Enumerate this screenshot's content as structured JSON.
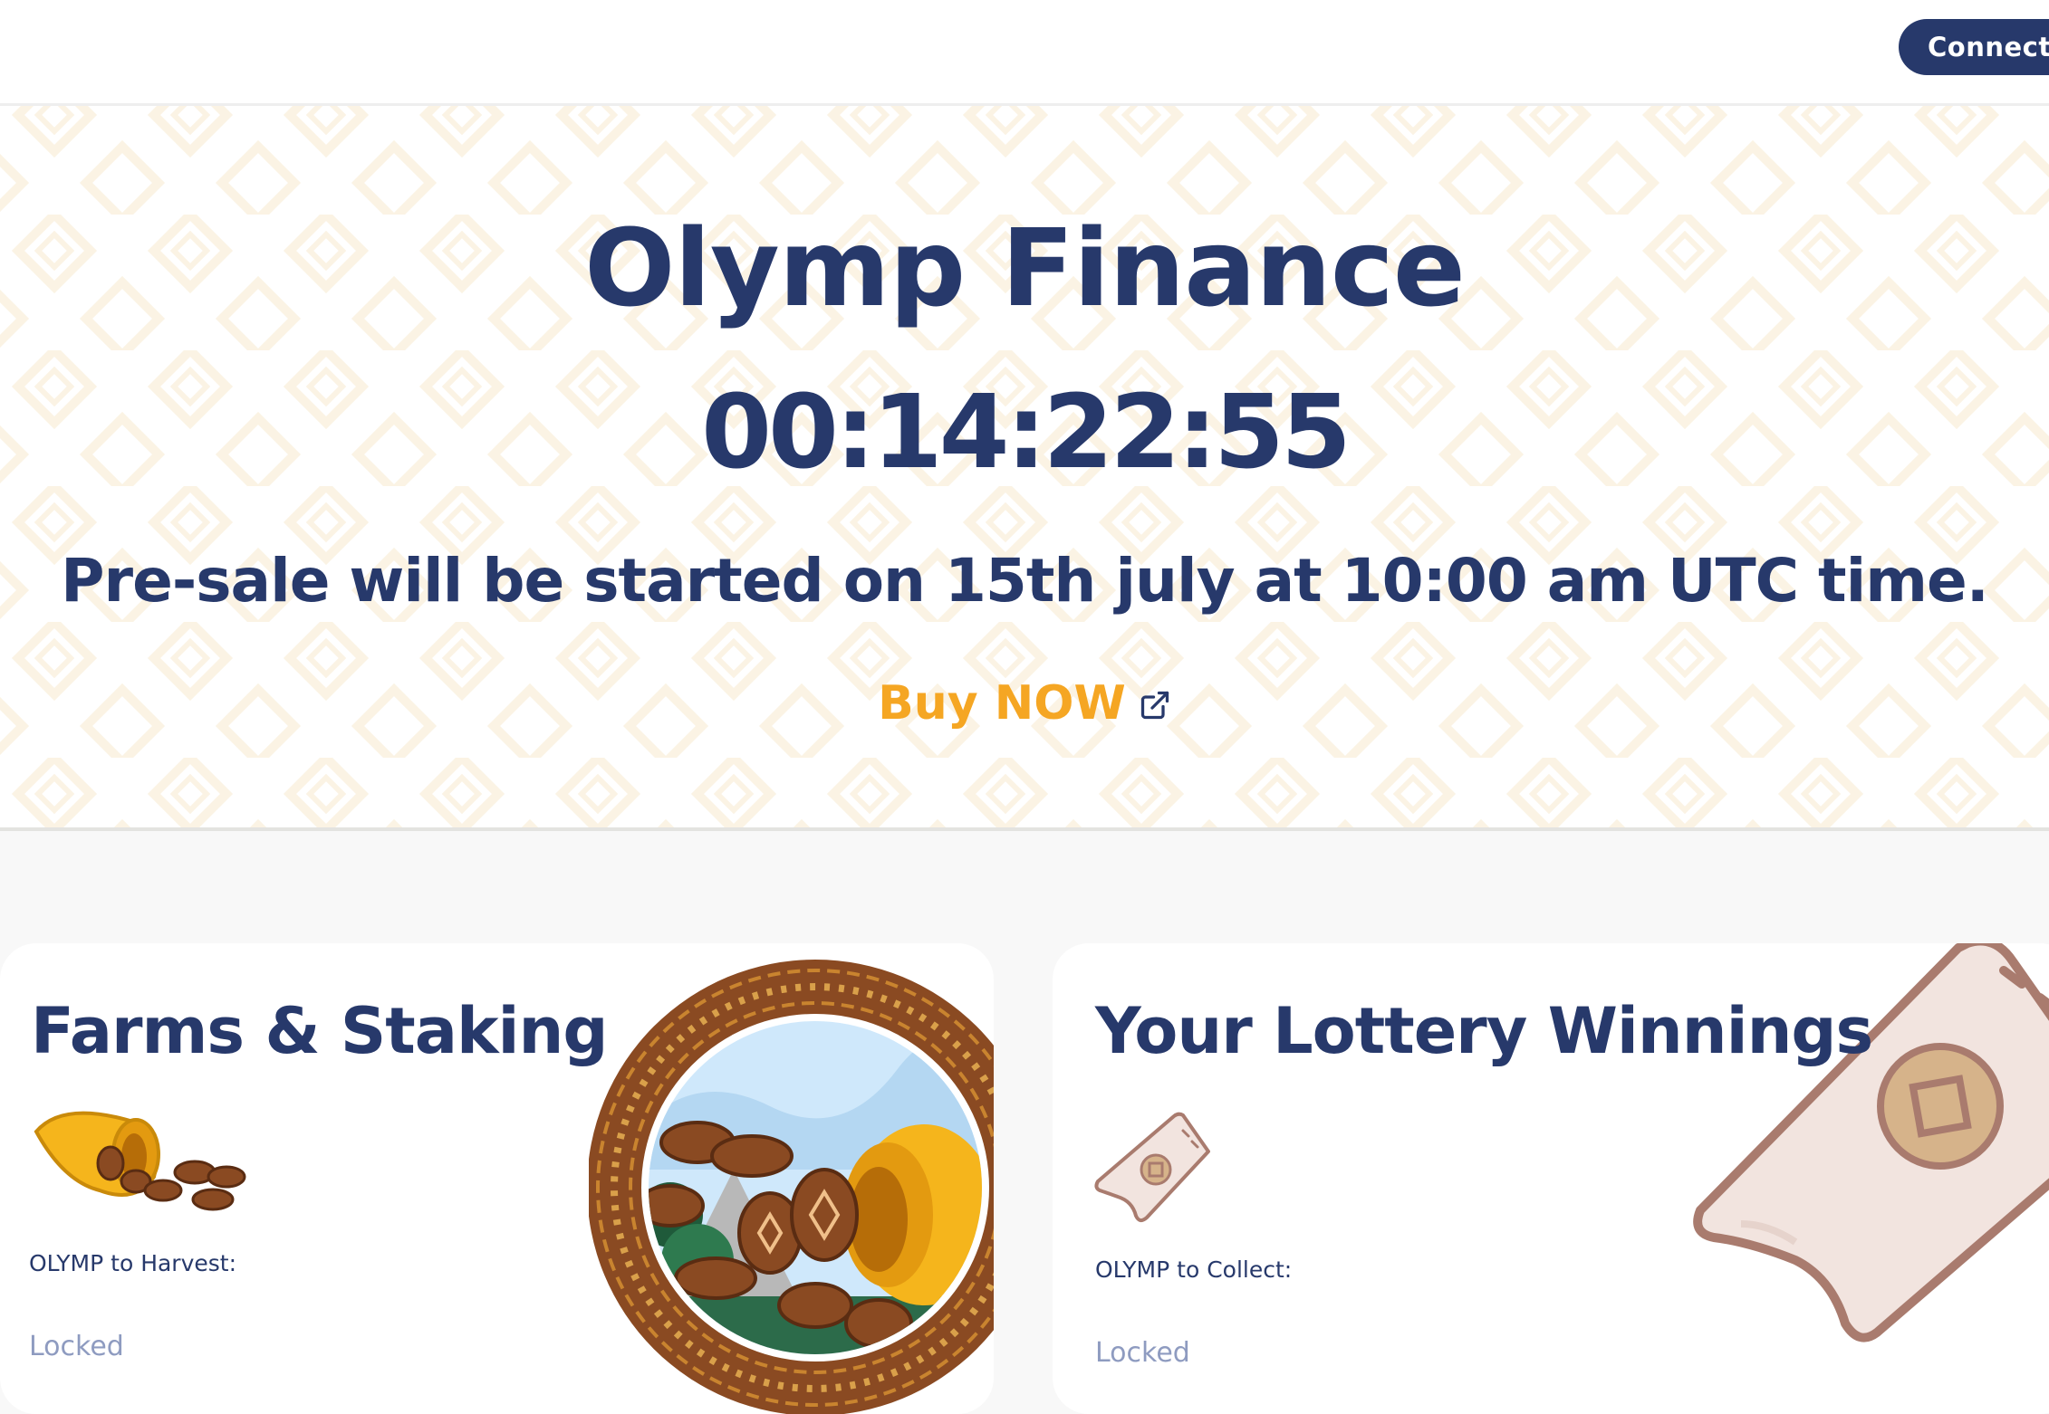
{
  "header": {
    "connect_label": "Connect"
  },
  "hero": {
    "title": "Olymp Finance",
    "countdown": "00:14:22:55",
    "presale_text": "Pre-sale will be started on 15th july at 10:00 am UTC time.",
    "buy_label": "Buy NOW",
    "buy_icon": "external-link-icon"
  },
  "cards": {
    "farms": {
      "title": "Farms & Staking",
      "harvest_label": "OLYMP to Harvest:",
      "harvest_value": "Locked",
      "icon": "cornucopia-coins-icon"
    },
    "lottery": {
      "title": "Your Lottery Winnings",
      "collect_label": "OLYMP to Collect:",
      "collect_value": "Locked",
      "icon": "lottery-ticket-icon"
    }
  },
  "colors": {
    "primary": "#27396b",
    "accent": "#f5a623",
    "muted": "#8e9bc0",
    "background": "#f8f8f8"
  }
}
